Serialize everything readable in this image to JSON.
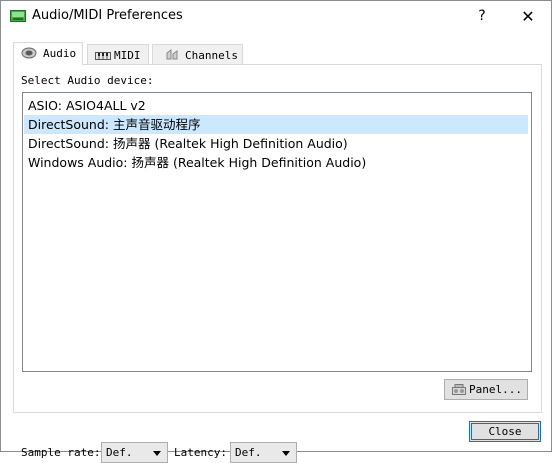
{
  "window": {
    "title": "Audio/MIDI Preferences",
    "help_glyph": "?",
    "close_glyph": "✕"
  },
  "tabs": [
    {
      "label": "Audio",
      "icon": "speaker-icon",
      "active": true
    },
    {
      "label": "MIDI",
      "icon": "keyboard-icon",
      "active": false
    },
    {
      "label": "Channels",
      "icon": "channels-icon",
      "active": false
    }
  ],
  "audio": {
    "select_label": "Select Audio device:",
    "devices": [
      "ASIO: ASIO4ALL v2",
      "DirectSound: 主声音驱动程序",
      "DirectSound: 扬声器 (Realtek High Definition Audio)",
      "Windows Audio: 扬声器 (Realtek High Definition Audio)"
    ],
    "selected_index": 1,
    "sample_rate_label": "Sample rate:",
    "sample_rate_value": "Def.",
    "latency_label": "Latency:",
    "latency_value": "Def.",
    "panel_button": "Panel..."
  },
  "footer": {
    "close_button": "Close"
  },
  "colors": {
    "selection": "#cce8ff",
    "default_button_border": "#0078d7"
  }
}
